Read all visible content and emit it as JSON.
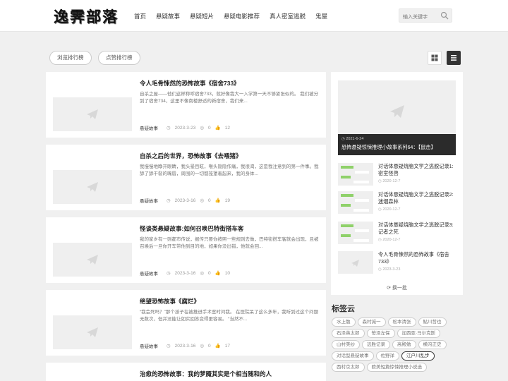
{
  "header": {
    "logo": "逸霁部落",
    "nav": [
      "首页",
      "悬疑故事",
      "悬疑短片",
      "悬疑电影推荐",
      "真人密室逃脱",
      "鬼屋"
    ],
    "search_placeholder": "输入关键字"
  },
  "rank_buttons": [
    "浏览排行榜",
    "点赞排行榜"
  ],
  "articles": [
    {
      "title": "令人毛骨悚然的恐怖故事《宿舍733》",
      "excerpt": "自杀之屋——他们这样称呼宿舍733，就好像我大一入学第一天不够紧张似的。 我们被分到了宿舍734，这里不像南楼舒适的新宿舍，我们来...",
      "category": "悬疑故事",
      "date": "2023-3-23",
      "views": "0",
      "likes": "12"
    },
    {
      "title": "自杀之后的世界，恐怖故事《去喂猪》",
      "excerpt": "我慢慢地睁开眼睛，我头晕目眩，喉头隐隐作痛，我很渴，这是我注意到的第一件事。我舔了舔干裂的嘴唇，周围的一切都笼罩着起来，我的身体...",
      "category": "悬疑故事",
      "date": "2023-3-16",
      "views": "0",
      "likes": "19"
    },
    {
      "title": "怪谈类悬疑故事:如何召唤巴特街搭车客",
      "excerpt": "我的家乡有一则都市传说，据传只要你按照一些规则去做，巴特街搭车客就会出现，且被召唤后一旦你开车带他到目的地，如果你没出错，他就会回...",
      "category": "悬疑故事",
      "date": "2023-3-16",
      "views": "0",
      "likes": "10"
    },
    {
      "title": "绝望恐怖故事《腐烂》",
      "excerpt": "“我会死吗？”那个孩子在被推进手术室时问我。 在医院呆了这么多年，我听到过这个问题无数次，但并没能让如实回答变得更容易。 “当然不...",
      "category": "悬疑故事",
      "date": "2023-3-16",
      "views": "0",
      "likes": "17"
    },
    {
      "title": "治愈的恐怖故事：我的梦魇其实是个相当随和的人",
      "excerpt": "",
      "category": "",
      "date": "",
      "views": "",
      "likes": ""
    }
  ],
  "sidebar": {
    "featured": {
      "date": "2021-6-24",
      "title": "恐怖悬疑惊悚推理小故事系列64：【鼠击】"
    },
    "items": [
      {
        "title": "对话体悬疑烧脑文学之逃脱记录1: 密室怪兽",
        "date": "2020-12-7"
      },
      {
        "title": "对话体悬疑烧脑文学之逃脱记录2: 迷烟森林",
        "date": "2020-12-7"
      },
      {
        "title": "对话体悬疑烧脑文学之逃脱记录3: 记者之死",
        "date": "2020-12-7"
      },
      {
        "title": "令人毛骨悚然的恐怖故事《宿舍733》",
        "date": "2023-3-23"
      }
    ],
    "refresh": "换一批"
  },
  "tags": {
    "title": "标签云",
    "items": [
      "水上勉",
      "森村诚一",
      "松本清张",
      "鮎川哲也",
      "石泽英太郎",
      "笹泽左保",
      "加西亚·马尔克斯",
      "山村美纱",
      "远胜记录",
      "高殿勉",
      "横沟正史",
      "对话型悬疑故事",
      "佐野洋",
      "江户川乱步",
      "西村京太郎",
      "欧美短篇惊悚推理小说选"
    ],
    "active": "江户川乱步"
  },
  "colors": {
    "accent": "#333333",
    "background": "#f0f0f0"
  }
}
